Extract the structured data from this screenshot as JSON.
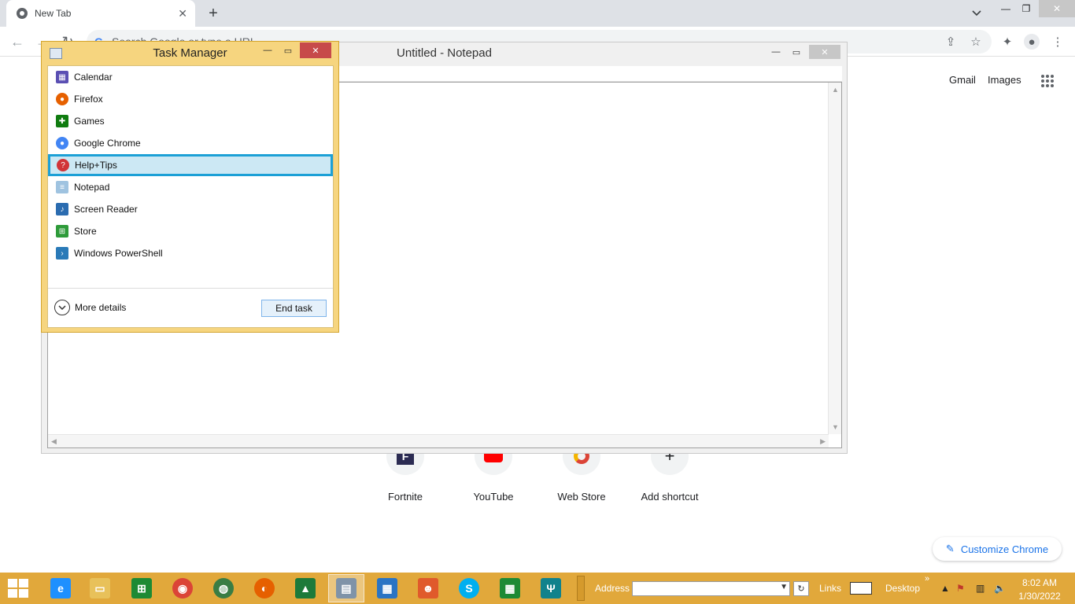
{
  "browser": {
    "tab_title": "New Tab",
    "omnibox_placeholder": "Search Google or type a URL",
    "top_links": [
      "Gmail",
      "Images"
    ],
    "shortcuts": [
      {
        "label": "Fortnite",
        "icon": "fortnite-icon",
        "color": "#2b2b52"
      },
      {
        "label": "YouTube",
        "icon": "youtube-icon",
        "color": "#ff0000"
      },
      {
        "label": "Web Store",
        "icon": "webstore-icon",
        "color": "#4285f4"
      },
      {
        "label": "Add shortcut",
        "icon": "plus-icon",
        "color": "#202124"
      }
    ],
    "customize_label": "Customize Chrome"
  },
  "notepad": {
    "title": "Untitled - Notepad"
  },
  "task_manager": {
    "title": "Task Manager",
    "apps": [
      {
        "name": "Calendar",
        "icon": "calendar-icon",
        "color": "#5a4fb3"
      },
      {
        "name": "Firefox",
        "icon": "firefox-icon",
        "color": "#e66000"
      },
      {
        "name": "Games",
        "icon": "games-icon",
        "color": "#107c10"
      },
      {
        "name": "Google Chrome",
        "icon": "chrome-icon",
        "color": "#4285f4"
      },
      {
        "name": "Help+Tips",
        "icon": "help-icon",
        "color": "#d13438",
        "selected": true
      },
      {
        "name": "Notepad",
        "icon": "notepad-icon",
        "color": "#9fc3e0"
      },
      {
        "name": "Screen Reader",
        "icon": "screen-reader-icon",
        "color": "#2b6cb0"
      },
      {
        "name": "Store",
        "icon": "store-icon",
        "color": "#2e9b3a"
      },
      {
        "name": "Windows PowerShell",
        "icon": "powershell-icon",
        "color": "#2a7ab8"
      }
    ],
    "more_details_label": "More details",
    "end_task_label": "End task",
    "selection_color": "#1ca0d6"
  },
  "taskbar": {
    "apps": [
      {
        "name": "internet-explorer-icon",
        "color": "#1e90ff",
        "glyph": "e"
      },
      {
        "name": "file-explorer-icon",
        "color": "#e8c15a",
        "glyph": "▭"
      },
      {
        "name": "store-icon",
        "color": "#1d8a34",
        "glyph": "⊞"
      },
      {
        "name": "chrome-icon",
        "color": "#db4437",
        "glyph": "◉"
      },
      {
        "name": "network-globe-icon",
        "color": "#3a7d44",
        "glyph": "◍"
      },
      {
        "name": "firefox-icon",
        "color": "#e66000",
        "glyph": "◐"
      },
      {
        "name": "finance-chart-icon",
        "color": "#1d7a3a",
        "glyph": "▲"
      },
      {
        "name": "task-manager-icon",
        "color": "#7f93a8",
        "glyph": "▤",
        "active": true
      },
      {
        "name": "control-panel-icon",
        "color": "#2a74c4",
        "glyph": "▦"
      },
      {
        "name": "people-icon",
        "color": "#e05a2b",
        "glyph": "☻"
      },
      {
        "name": "skype-icon",
        "color": "#00aff0",
        "glyph": "S"
      },
      {
        "name": "calculator-icon",
        "color": "#1d8a34",
        "glyph": "▦"
      },
      {
        "name": "food-icon",
        "color": "#11828c",
        "glyph": "Ψ"
      }
    ],
    "address_label": "Address",
    "address_value": "",
    "links_label": "Links",
    "desktop_label": "Desktop",
    "time": "8:02 AM",
    "date": "1/30/2022"
  }
}
